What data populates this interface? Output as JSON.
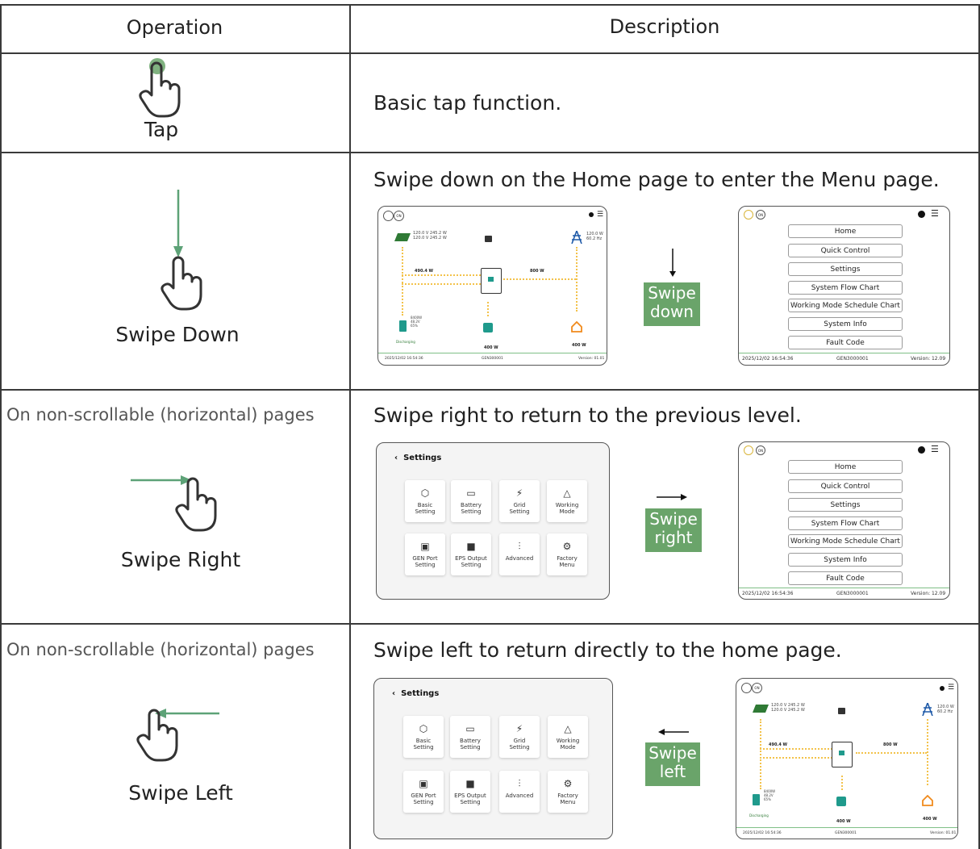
{
  "table": {
    "header_operation": "Operation",
    "header_description": "Description"
  },
  "rows": {
    "tap": {
      "label": "Tap",
      "description": "Basic tap function."
    },
    "swipe_down": {
      "label": "Swipe Down",
      "description": "Swipe down on the Home page to enter the Menu page.",
      "badge_line1": "Swipe",
      "badge_line2": "down"
    },
    "swipe_right": {
      "note": "On non-scrollable (horizontal) pages",
      "label": "Swipe Right",
      "description": "Swipe right to return to the previous level.",
      "badge_line1": "Swipe",
      "badge_line2": "right"
    },
    "swipe_left": {
      "note": "On non-scrollable (horizontal) pages",
      "label": "Swipe Left",
      "description": "Swipe left to return directly to the home page.",
      "badge_line1": "Swipe",
      "badge_line2": "left"
    }
  },
  "menu_screen": {
    "on_label": "ON",
    "items": [
      "Home",
      "Quick Control",
      "Settings",
      "System Flow Chart",
      "Working Mode Schedule Chart",
      "System Info",
      "Fault Code"
    ],
    "footer_time": "2025/12/02 16:54:36",
    "footer_serial": "GEN3000001",
    "footer_version": "Version: 12.09"
  },
  "home_screen": {
    "on_label": "ON",
    "pv_values": "120.0 V 245.2 W\n120.0 V 245.2 W",
    "grid_values": "120.0 W\n60.2 Hz",
    "left_power": "490.4 W",
    "right_power": "800 W",
    "battery_values": "8400W\n48.2V\n65%",
    "battery_status": "Discharging",
    "eps_load": "400 W",
    "home_load": "400 W",
    "footer_time": "2025/12/02 16:54:36",
    "footer_serial": "GEN300001",
    "footer_version": "Version: 01.01"
  },
  "settings_screen": {
    "title": "Settings",
    "tiles": [
      {
        "label": "Basic\nSetting",
        "icon": "hexagon-gear-icon"
      },
      {
        "label": "Battery\nSetting",
        "icon": "battery-icon"
      },
      {
        "label": "Grid\nSetting",
        "icon": "grid-tower-icon"
      },
      {
        "label": "Working\nMode",
        "icon": "triangle-icon"
      },
      {
        "label": "GEN Port\nSetting",
        "icon": "generator-icon"
      },
      {
        "label": "EPS Output\nSetting",
        "icon": "eps-output-icon"
      },
      {
        "label": "Advanced",
        "icon": "sliders-icon"
      },
      {
        "label": "Factory\nMenu",
        "icon": "factory-gear-icon"
      }
    ]
  },
  "colors": {
    "accent_green": "#6aa46a",
    "arrow_green": "#5da277",
    "flow_yellow": "#f3c24a",
    "battery_teal": "#1f9a8c"
  }
}
